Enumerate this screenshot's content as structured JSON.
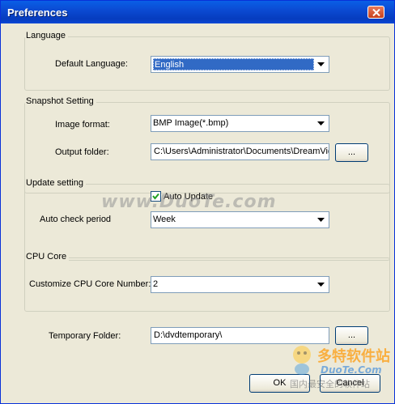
{
  "window": {
    "title": "Preferences"
  },
  "language": {
    "group_label": "Language",
    "default_language_label": "Default Language:",
    "default_language_value": "English"
  },
  "snapshot": {
    "group_label": "Snapshot Setting",
    "image_format_label": "Image format:",
    "image_format_value": "BMP Image(*.bmp)",
    "output_folder_label": "Output folder:",
    "output_folder_value": "C:\\Users\\Administrator\\Documents\\DreamVid",
    "browse_label": "..."
  },
  "update": {
    "group_label": "Update setting",
    "auto_update_label": "Auto Update",
    "auto_update_checked": true,
    "auto_check_period_label": "Auto check period",
    "auto_check_period_value": "Week"
  },
  "cpu": {
    "group_label": "CPU Core",
    "customize_label": "Customize CPU Core Number:",
    "customize_value": "2"
  },
  "temp": {
    "label": "Temporary Folder:",
    "value": "D:\\dvdtemporary\\",
    "browse_label": "..."
  },
  "footer": {
    "ok_label": "OK",
    "cancel_label": "Cancel"
  },
  "watermark": {
    "text1": "www.DuoTe.com",
    "text2_cn": "多特软件站",
    "text2_url": "DuoTe.Com",
    "text3_cn": "国内最安全的软件站"
  },
  "colors": {
    "title_bar": "#0a5fe6",
    "selection": "#316ac5",
    "dialog_bg": "#ece9d8"
  }
}
